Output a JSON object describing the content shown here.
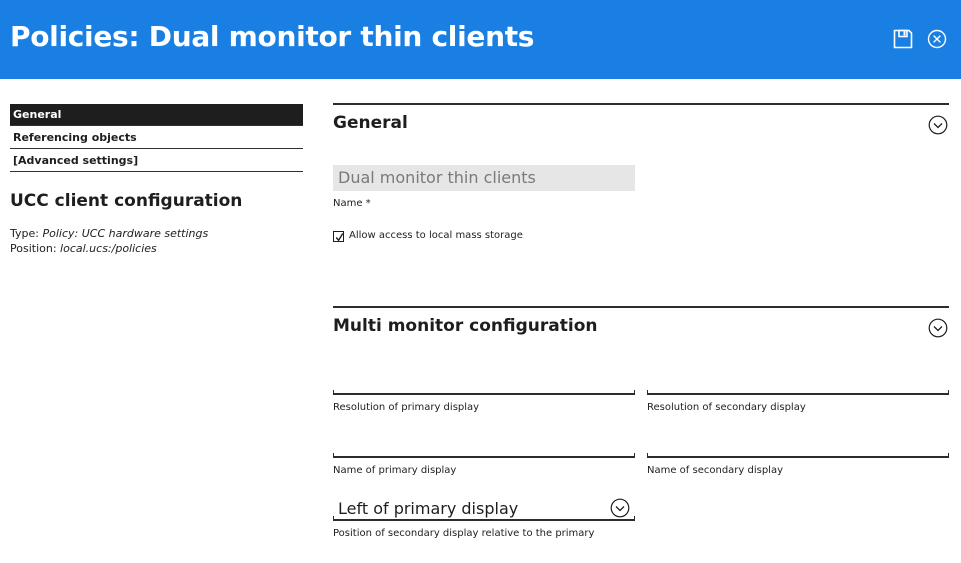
{
  "header": {
    "title": "Policies: Dual monitor thin clients",
    "bg_color": "#1a7fe3",
    "save_icon": "save-icon",
    "close_icon": "close-icon"
  },
  "nav": {
    "items": [
      {
        "label": "General",
        "active": true
      },
      {
        "label": "Referencing objects",
        "active": false
      },
      {
        "label": "[Advanced settings]",
        "active": false
      }
    ]
  },
  "object": {
    "title": "UCC client configuration",
    "type_label": "Type:",
    "type_value": "Policy: UCC hardware settings",
    "position_label": "Position:",
    "position_value": "local.ucs:/policies"
  },
  "sections": {
    "general": {
      "title": "General",
      "name_value": "Dual monitor thin clients",
      "name_label": "Name *",
      "mass_storage_label": "Allow access to local mass storage",
      "mass_storage_checked": true
    },
    "multi_monitor": {
      "title": "Multi monitor configuration",
      "primary_resolution_value": "",
      "primary_resolution_label": "Resolution of primary display",
      "secondary_resolution_value": "",
      "secondary_resolution_label": "Resolution of secondary display",
      "primary_name_value": "",
      "primary_name_label": "Name of primary display",
      "secondary_name_value": "",
      "secondary_name_label": "Name of secondary display",
      "position_selected": "Left of primary display",
      "position_label": "Position of secondary display relative to the primary"
    }
  }
}
